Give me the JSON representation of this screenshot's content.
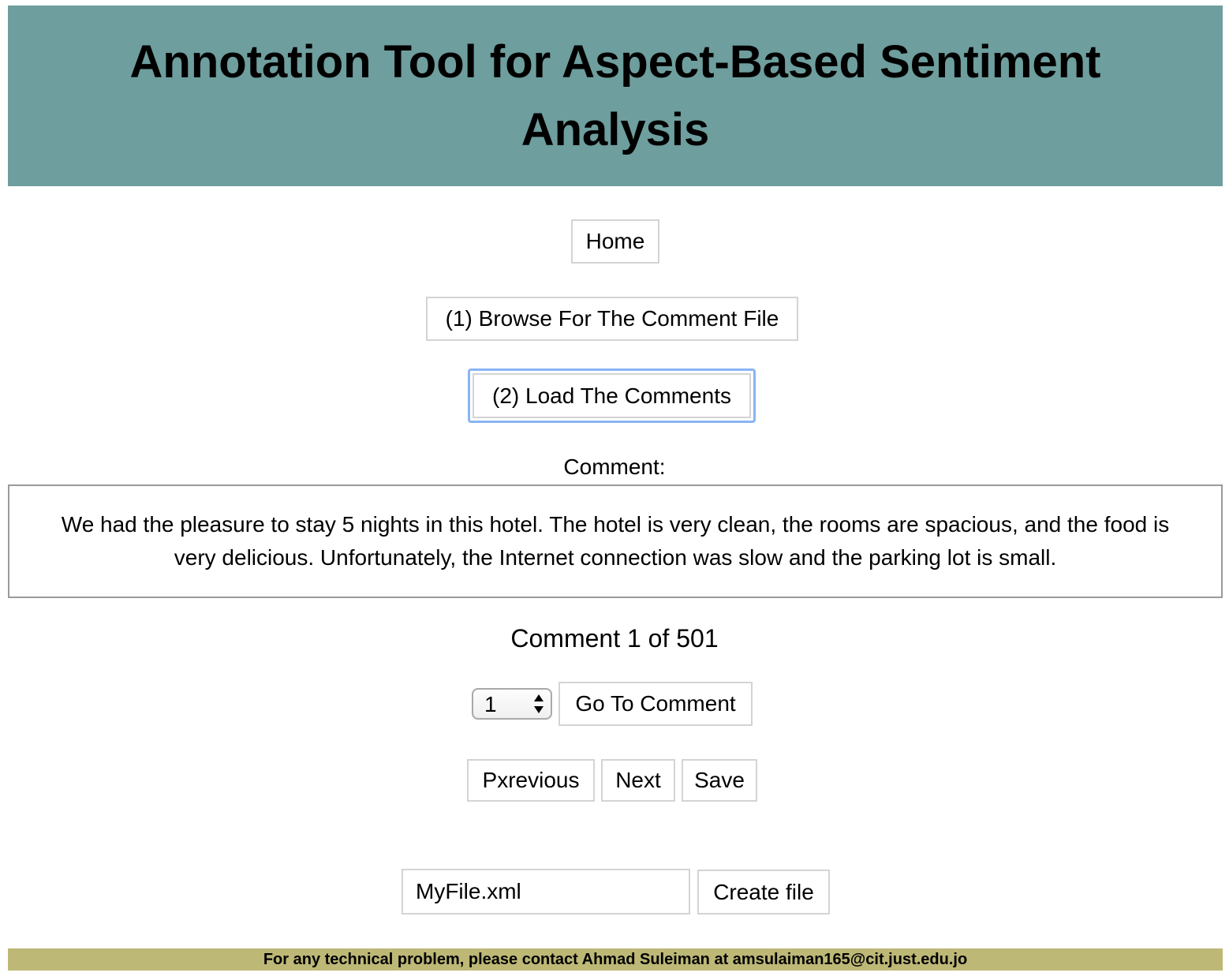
{
  "header": {
    "title": "Annotation Tool for Aspect-Based Sentiment Analysis"
  },
  "nav": {
    "home_label": "Home",
    "browse_label": "(1) Browse For The Comment File",
    "load_label": "(2) Load The Comments"
  },
  "comment": {
    "heading": "Comment:",
    "text": "We had the pleasure to stay 5 nights in this hotel. The hotel is very clean, the rooms are spacious, and the food is very delicious. Unfortunately, the Internet connection was slow and the parking lot is small.",
    "counter": "Comment 1 of 501"
  },
  "goto": {
    "selected_value": "1",
    "button_label": "Go To Comment"
  },
  "navigation": {
    "previous_label": "Pxrevious",
    "next_label": "Next",
    "save_label": "Save"
  },
  "file": {
    "filename_value": "MyFile.xml",
    "create_label": "Create file"
  },
  "footer": {
    "text": "For any technical problem, please contact Ahmad Suleiman at amsulaiman165@cit.just.edu.jo"
  },
  "colors": {
    "header_bg": "#6e9e9e",
    "footer_bg": "#bdb876",
    "focus_ring": "#8ab4f3"
  }
}
